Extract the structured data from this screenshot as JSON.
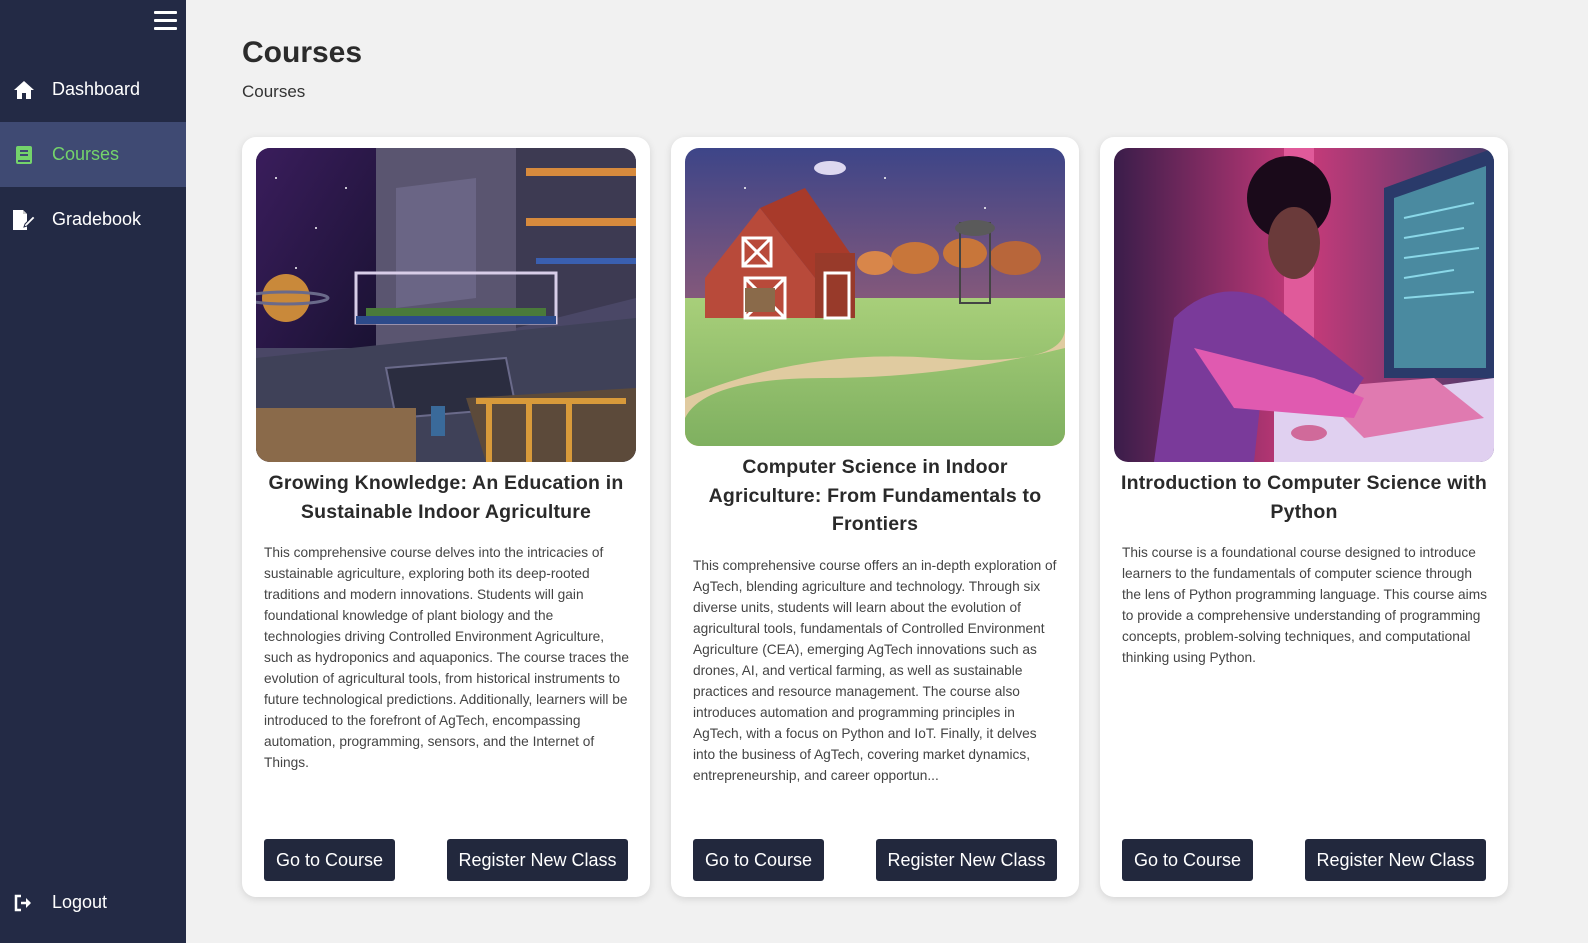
{
  "sidebar": {
    "menu_icon": "hamburger-menu-icon",
    "items": [
      {
        "label": "Dashboard",
        "icon": "home-icon",
        "active": false
      },
      {
        "label": "Courses",
        "icon": "book-icon",
        "active": true
      },
      {
        "label": "Gradebook",
        "icon": "file-signature-icon",
        "active": false
      }
    ],
    "logout": {
      "label": "Logout",
      "icon": "sign-out-icon"
    },
    "colors": {
      "background": "#232a45",
      "active_background": "#3f4a73",
      "active_text": "#74d46b"
    }
  },
  "header": {
    "title": "Courses",
    "breadcrumb": "Courses"
  },
  "courses": [
    {
      "title": "Growing Knowledge: An Education in Sustainable Indoor Agriculture",
      "description": "This comprehensive course delves into the intricacies of sustainable agriculture, exploring both its deep-rooted traditions and modern innovations. Students will gain foundational knowledge of plant biology and the technologies driving Controlled Environment Agriculture, such as hydroponics and aquaponics. The course traces the evolution of agricultural tools, from historical instruments to future technological predictions. Additionally, learners will be introduced to the forefront of AgTech, encompassing automation, programming, sensors, and the Internet of Things.",
      "image": "space-station-hydroponics-image",
      "go_label": "Go to Course",
      "register_label": "Register New Class"
    },
    {
      "title": "Computer Science in Indoor Agriculture: From Fundamentals to Frontiers",
      "description": "This comprehensive course offers an in-depth exploration of AgTech, blending agriculture and technology. Through six diverse units, students will learn about the evolution of agricultural tools, fundamentals of Controlled Environment Agriculture (CEA), emerging AgTech innovations such as drones, AI, and vertical farming, as well as sustainable practices and resource management. The course also introduces automation and programming principles in AgTech, with a focus on Python and IoT. Finally, it delves into the business of AgTech, covering market dynamics, entrepreneurship, and career opportun...",
      "image": "farm-barn-image",
      "go_label": "Go to Course",
      "register_label": "Register New Class"
    },
    {
      "title": "Introduction to Computer Science with Python",
      "description": "This course is a foundational course designed to introduce learners to the fundamentals of computer science through the lens of Python programming language. This course aims to provide a comprehensive understanding of programming concepts, problem-solving techniques, and computational thinking using Python.",
      "image": "student-coding-image",
      "go_label": "Go to Course",
      "register_label": "Register New Class"
    }
  ]
}
